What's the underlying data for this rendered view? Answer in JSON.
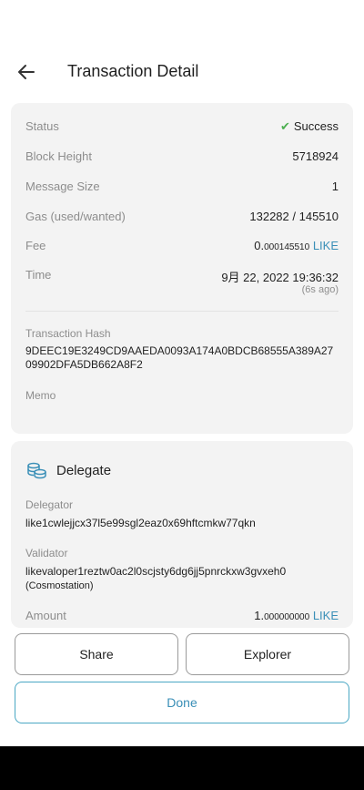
{
  "header": {
    "title": "Transaction Detail",
    "back_icon": "arrow-left-icon"
  },
  "summary": {
    "status_label": "Status",
    "status_value": "Success",
    "block_height_label": "Block Height",
    "block_height_value": "5718924",
    "message_size_label": "Message Size",
    "message_size_value": "1",
    "gas_label": "Gas (used/wanted)",
    "gas_value": "132282 / 145510",
    "fee_label": "Fee",
    "fee_int": "0.",
    "fee_dec": "000145510",
    "fee_unit": "LIKE",
    "time_label": "Time",
    "time_value": "9月 22, 2022 19:36:32",
    "time_ago": "(6s ago)",
    "hash_label": "Transaction Hash",
    "hash_value": "9DEEC19E3249CD9AAEDA0093A174A0BDCB68555A389A2709902DFA5DB662A8F2",
    "memo_label": "Memo"
  },
  "message": {
    "title": "Delegate",
    "icon": "coins-stack-icon",
    "delegator_label": "Delegator",
    "delegator_value": "like1cwlejjcx37l5e99sgl2eaz0x69hftcmkw77qkn",
    "validator_label": "Validator",
    "validator_value": "likevaloper1reztw0ac2l0scjsty6dg6jj5pnrckxw3gvxeh0",
    "validator_name": "(Cosmostation)",
    "amount_label": "Amount",
    "amount_int": "1.",
    "amount_dec": "000000000",
    "amount_unit": "LIKE"
  },
  "buttons": {
    "share": "Share",
    "explorer": "Explorer",
    "done": "Done"
  },
  "colors": {
    "accent": "#3a8fb7",
    "success": "#4caf50",
    "card": "#f3f3f3"
  }
}
